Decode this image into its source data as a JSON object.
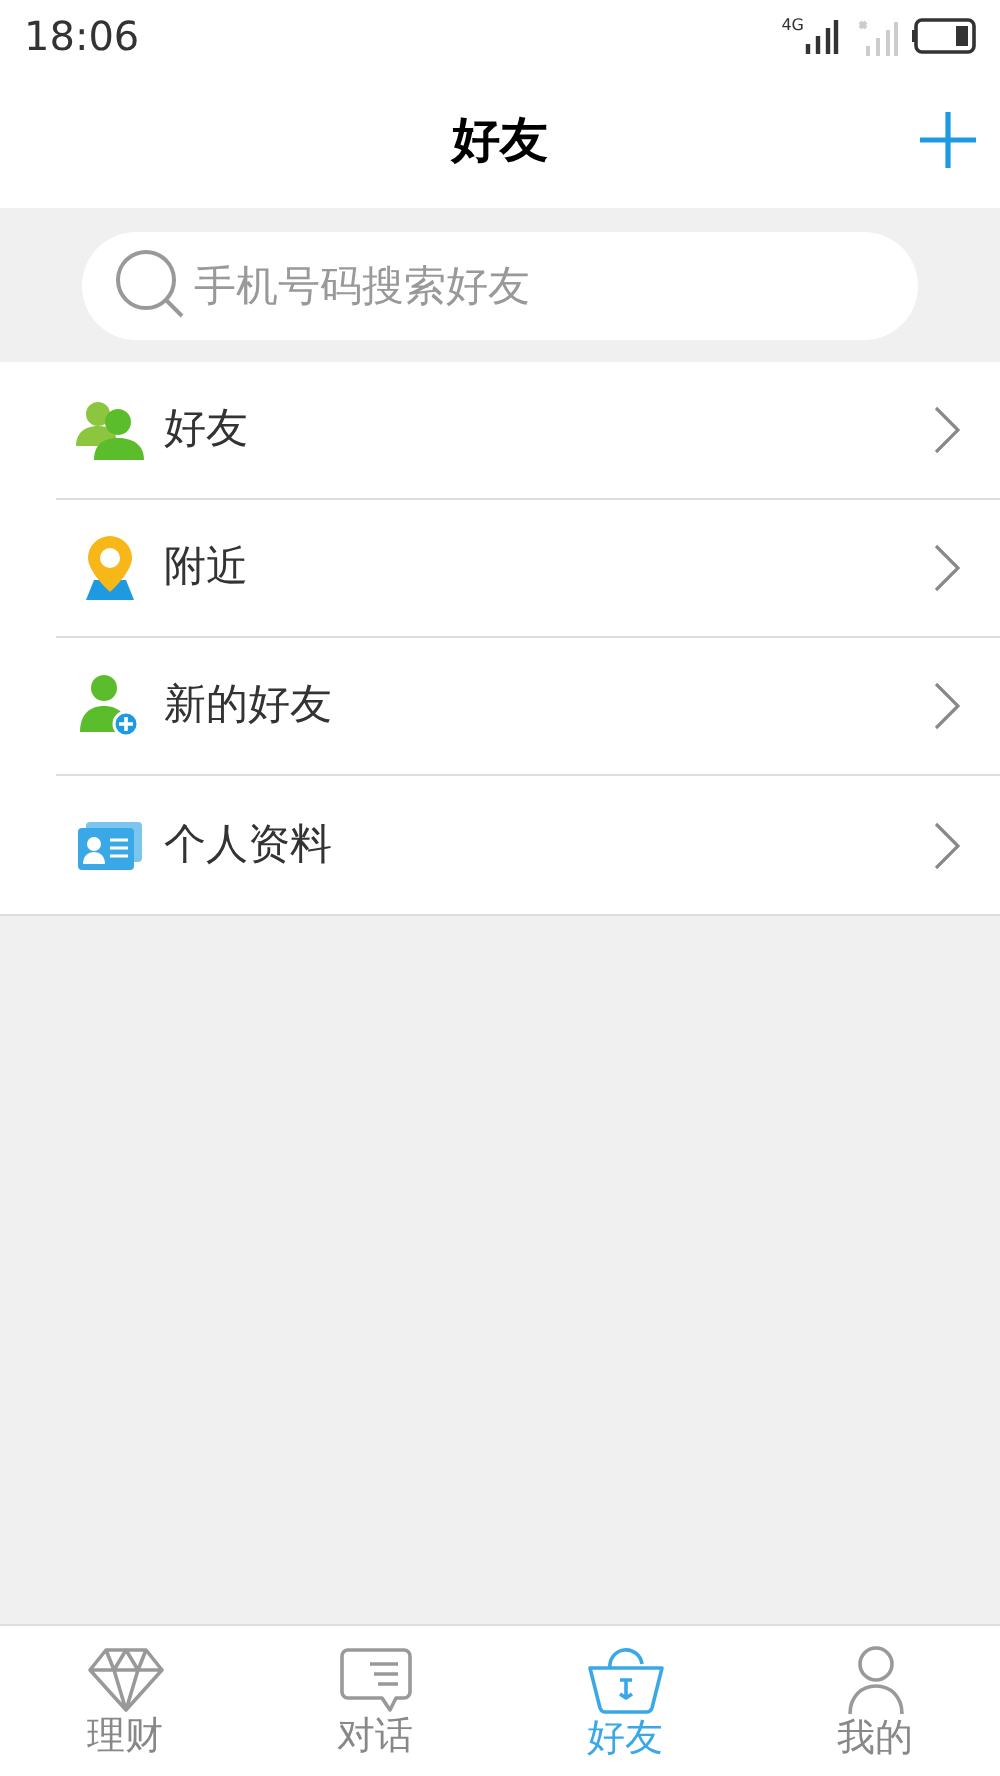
{
  "status_bar": {
    "time": "18:06",
    "network": "4G"
  },
  "header": {
    "title": "好友"
  },
  "search": {
    "placeholder": "手机号码搜索好友"
  },
  "menu": [
    {
      "kind": "friends",
      "label": "好友"
    },
    {
      "kind": "nearby",
      "label": "附近"
    },
    {
      "kind": "new",
      "label": "新的好友"
    },
    {
      "kind": "profile",
      "label": "个人资料"
    }
  ],
  "tabs": [
    {
      "kind": "finance",
      "label": "理财",
      "selected": false
    },
    {
      "kind": "chat",
      "label": "对话",
      "selected": false
    },
    {
      "kind": "friends",
      "label": "好友",
      "selected": true
    },
    {
      "kind": "me",
      "label": "我的",
      "selected": false
    }
  ]
}
